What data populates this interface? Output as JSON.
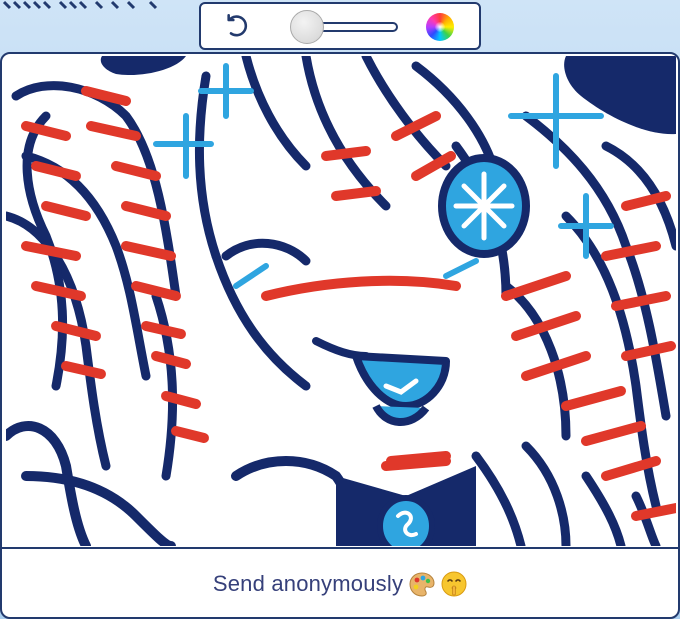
{
  "toolbar": {
    "undo_icon": "undo-icon",
    "brush_size_slider": {
      "value": 0.0
    },
    "color_picker_icon": "color-wheel-icon"
  },
  "canvas": {
    "colors": {
      "outline": "#15296a",
      "red": "#e0382a",
      "blue": "#2fa5e0",
      "white": "#ffffff"
    }
  },
  "footer": {
    "send_label": "Send anonymously",
    "emoji_1": "palette-emoji",
    "emoji_2": "shushing-face-emoji"
  }
}
